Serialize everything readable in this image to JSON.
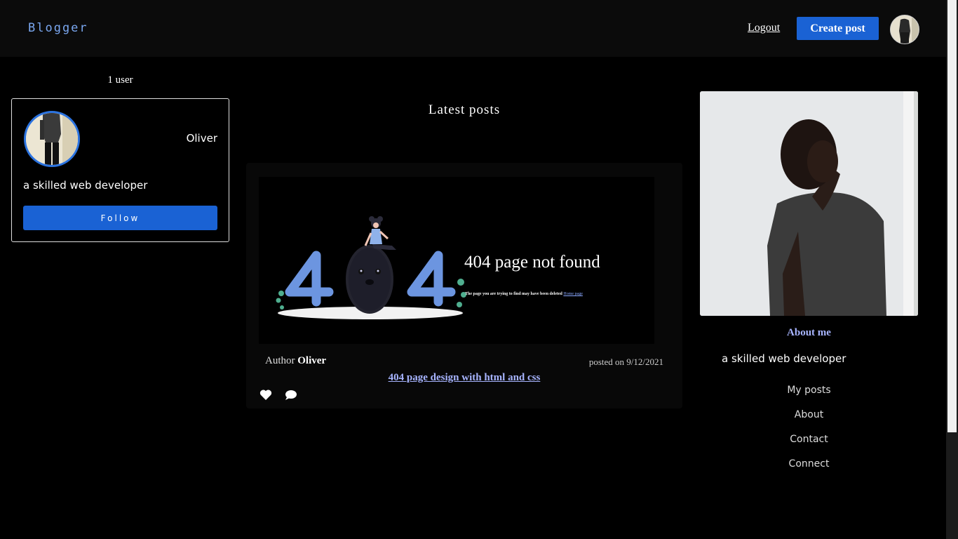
{
  "header": {
    "brand": "Blogger",
    "logout_label": "Logout",
    "create_post_label": "Create post"
  },
  "sidebar": {
    "user_count": "1 user",
    "user": {
      "name": "Oliver",
      "bio": "a skilled web developer",
      "follow_label": "Follow"
    }
  },
  "main": {
    "title": "Latest posts",
    "posts": [
      {
        "image_title": "404 page not found",
        "image_subtitle": "The page you are trying to find may have been deleted",
        "image_link": "Home page",
        "author_prefix": "Author",
        "author": "Oliver",
        "date": "posted on 9/12/2021",
        "title": "404 page design with html and css",
        "like_icon": "heart-icon",
        "comment_icon": "comment-icon"
      }
    ]
  },
  "profile": {
    "about_title": "About me",
    "about_text": "a skilled web developer",
    "links": [
      "My posts",
      "About",
      "Contact",
      "Connect"
    ]
  },
  "colors": {
    "accent": "#1a62d4",
    "link": "#a7b4ff",
    "background": "#000000",
    "header_bg": "#0b0b0b"
  }
}
